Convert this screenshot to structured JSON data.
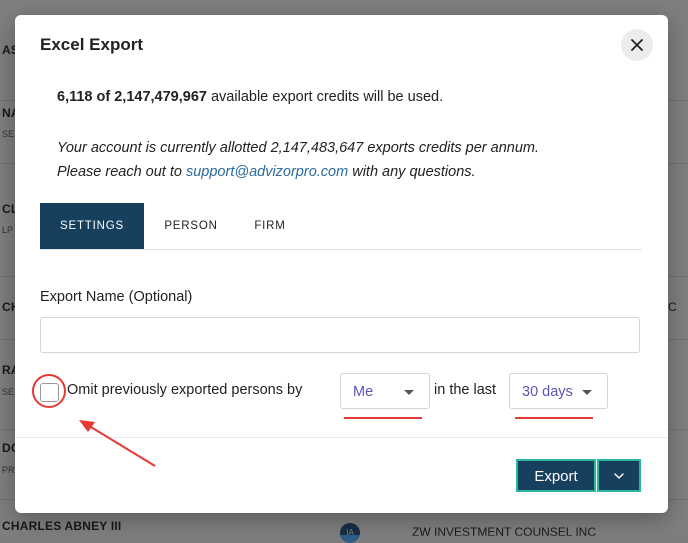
{
  "background": {
    "rows": [
      {
        "name": "AS",
        "sub": "",
        "right": ""
      },
      {
        "name": "NA",
        "sub": "SE",
        "right": ""
      },
      {
        "name": "CL",
        "sub": "LP",
        "right": ""
      },
      {
        "name": "CH",
        "sub": "",
        "right": "C"
      },
      {
        "name": "RA",
        "sub": "SE",
        "right": ""
      },
      {
        "name": "DO",
        "sub": "PR",
        "right": ""
      },
      {
        "name": "CHARLES ABNEY III",
        "sub": "",
        "right": "ZW INVESTMENT COUNSEL INC"
      }
    ],
    "badge": "IA"
  },
  "modal": {
    "title": "Excel Export",
    "credits_bold": "6,118 of 2,147,479,967",
    "credits_rest": " available export credits will be used.",
    "allot_line1": "Your account is currently allotted 2,147,483,647 exports credits per annum.",
    "allot_line2_pre": "Please reach out to ",
    "support_email": "support@advizorpro.com",
    "allot_line2_post": " with any questions.",
    "tabs": [
      {
        "label": "SETTINGS",
        "active": true
      },
      {
        "label": "PERSON",
        "active": false
      },
      {
        "label": "FIRM",
        "active": false
      }
    ],
    "export_name_label": "Export Name (Optional)",
    "export_name_value": "",
    "omit_label": "Omit previously exported persons by",
    "omit_checked": false,
    "by_select_value": "Me",
    "in_last_label": "in the last",
    "period_select_value": "30 days",
    "export_button": "Export"
  },
  "colors": {
    "primary": "#16405e",
    "accent_border": "#2bb6a0",
    "annotation": "#e53935",
    "select_text": "#5b56b8",
    "link": "#2a6a9e"
  },
  "icons": {
    "close": "close-icon",
    "caret": "caret-down-icon",
    "dropdown": "chevron-down-icon"
  }
}
